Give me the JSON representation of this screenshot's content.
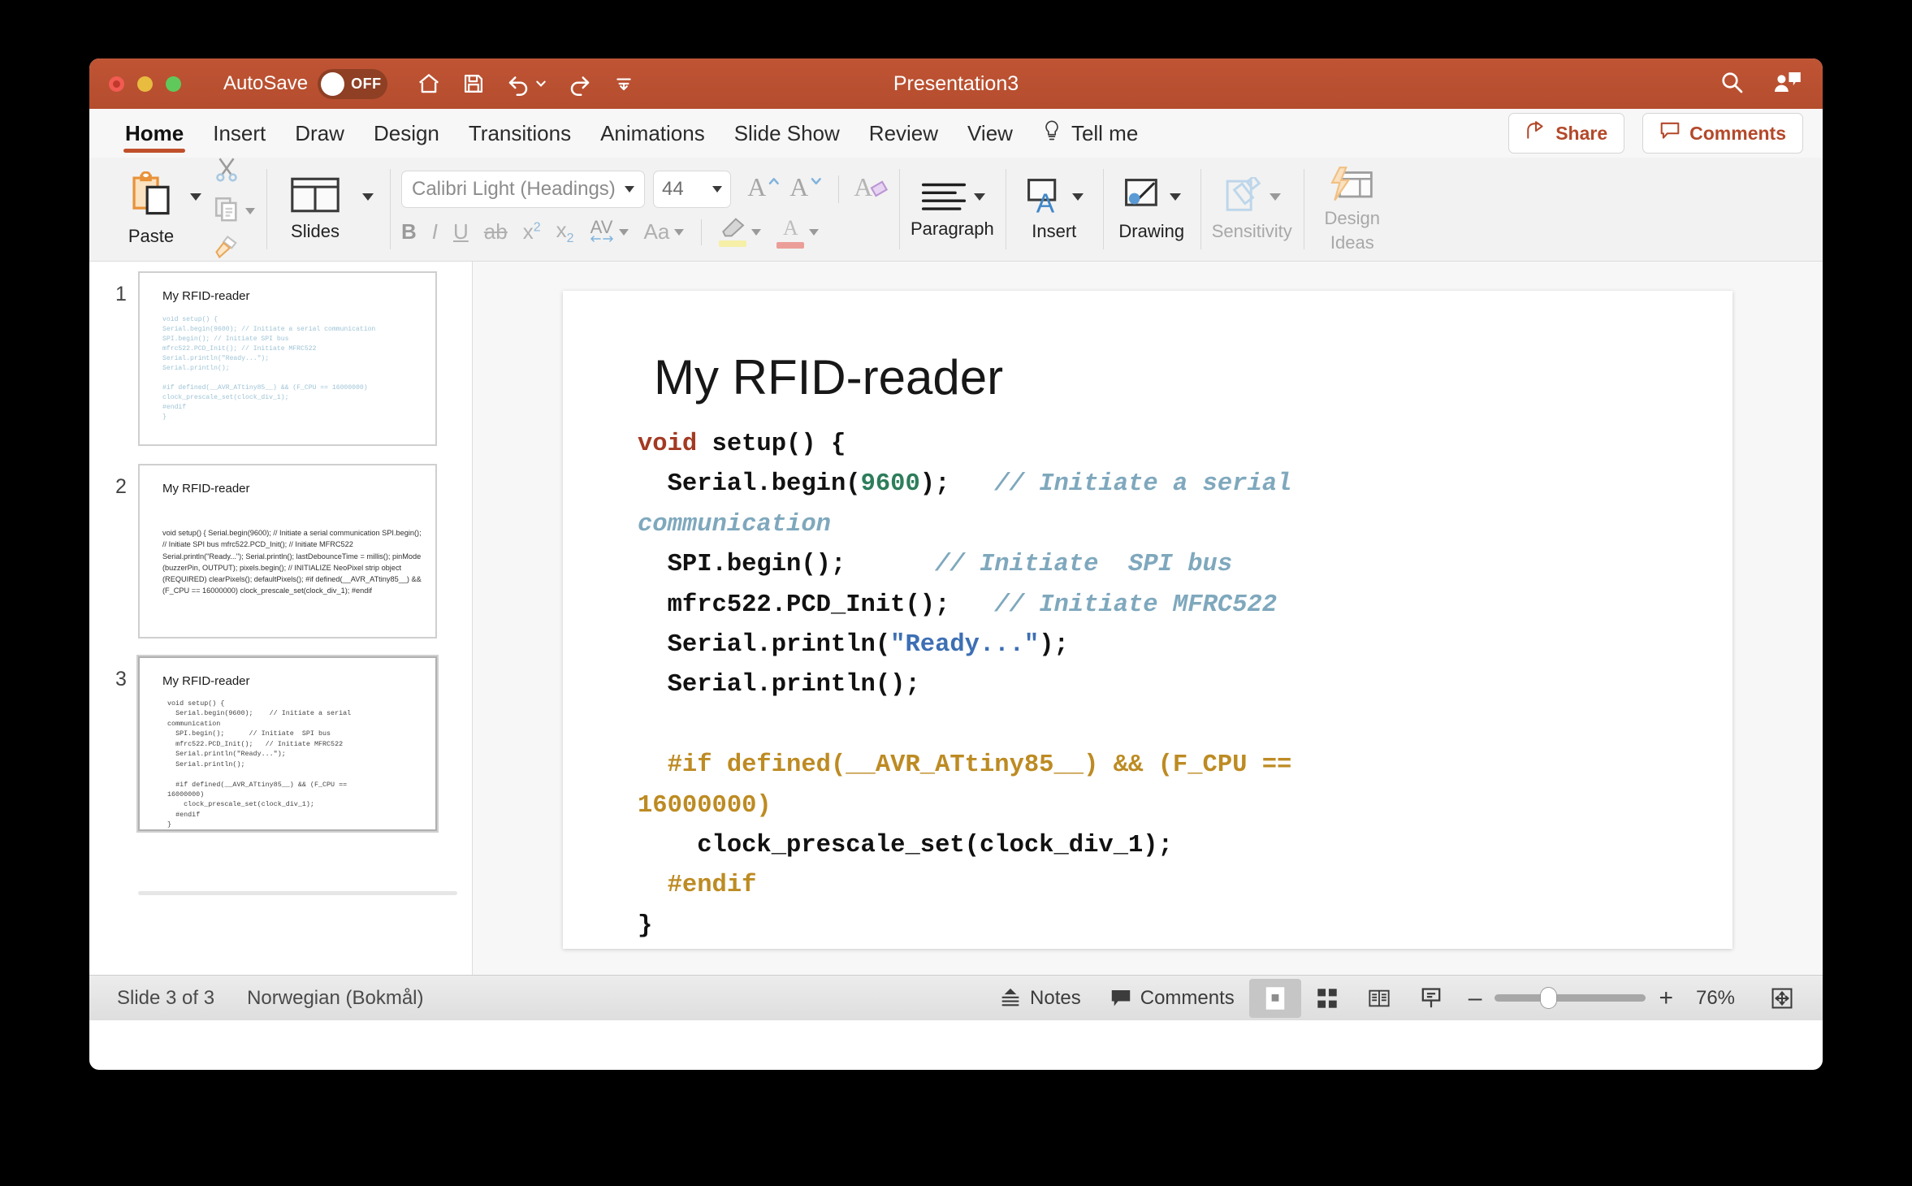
{
  "titlebar": {
    "autosave_label": "AutoSave",
    "autosave_state": "OFF",
    "window_title": "Presentation3",
    "icons": [
      "home-icon",
      "save-icon",
      "undo-icon",
      "redo-icon",
      "customize-toolbar-icon",
      "search-icon",
      "account-icon"
    ]
  },
  "tabs": [
    {
      "label": "Home",
      "active": true
    },
    {
      "label": "Insert",
      "active": false
    },
    {
      "label": "Draw",
      "active": false
    },
    {
      "label": "Design",
      "active": false
    },
    {
      "label": "Transitions",
      "active": false
    },
    {
      "label": "Animations",
      "active": false
    },
    {
      "label": "Slide Show",
      "active": false
    },
    {
      "label": "Review",
      "active": false
    },
    {
      "label": "View",
      "active": false
    },
    {
      "label": "Tell me",
      "active": false
    }
  ],
  "tab_actions": {
    "share_label": "Share",
    "comments_label": "Comments"
  },
  "ribbon": {
    "paste_label": "Paste",
    "slides_label": "Slides",
    "font_name": "Calibri Light (Headings)",
    "font_size": "44",
    "bold": "B",
    "italic": "I",
    "underline": "U",
    "strikethrough": "ab",
    "superscript": "x",
    "superscript_sup": "2",
    "subscript": "x",
    "subscript_sub": "2",
    "char_spacing": "AV",
    "change_case": "Aa",
    "highlight_letter": "A",
    "font_color_letter": "A",
    "grow_font": "A",
    "shrink_font": "A",
    "clear_format": "A",
    "paragraph_label": "Paragraph",
    "insert_label": "Insert",
    "drawing_label": "Drawing",
    "sensitivity_label": "Sensitivity",
    "design_ideas_label_1": "Design",
    "design_ideas_label_2": "Ideas"
  },
  "thumbnails": [
    {
      "number": "1",
      "title": "My RFID-reader",
      "body": "void setup() {\nSerial.begin(9600); // Initiate a serial communication\nSPI.begin(); // Initiate SPI bus\nmfrc522.PCD_Init(); // Initiate MFRC522\nSerial.println(\"Ready...\");\nSerial.println();\n\n#if defined(__AVR_ATtiny85__) && (F_CPU == 16000000)\nclock_prescale_set(clock_div_1);\n#endif\n}",
      "selected": false
    },
    {
      "number": "2",
      "title": "My RFID-reader",
      "body": "void setup() { Serial.begin(9600); // Initiate a serial communication SPI.begin(); // Initiate SPI bus mfrc522.PCD_Init(); // Initiate MFRC522 Serial.println(\"Ready...\"); Serial.println(); lastDebounceTime = millis(); pinMode (buzzerPin, OUTPUT); pixels.begin(); // INITIALIZE NeoPixel strip object (REQUIRED) clearPixels(); defaultPixels(); #if defined(__AVR_ATtiny85__) && (F_CPU == 16000000) clock_prescale_set(clock_div_1); #endif",
      "selected": false
    },
    {
      "number": "3",
      "title": "My RFID-reader",
      "body": "void setup() {\n  Serial.begin(9600);    // Initiate a serial\ncommunication\n  SPI.begin();      // Initiate  SPI bus\n  mfrc522.PCD_Init();   // Initiate MFRC522\n  Serial.println(\"Ready...\");\n  Serial.println();\n\n  #if defined(__AVR_ATtiny85__) && (F_CPU ==\n16000000)\n    clock_prescale_set(clock_div_1);\n  #endif\n}",
      "selected": true
    }
  ],
  "slide": {
    "title": "My RFID-reader",
    "code_lines": [
      {
        "tokens": [
          {
            "t": "void",
            "c": "c-kw"
          },
          {
            "t": " setup() {",
            "c": "c-plain"
          }
        ]
      },
      {
        "tokens": [
          {
            "t": "  Serial.begin(",
            "c": "c-plain"
          },
          {
            "t": "9600",
            "c": "c-num"
          },
          {
            "t": ");   ",
            "c": "c-plain"
          },
          {
            "t": "// Initiate a serial",
            "c": "c-cmt"
          }
        ]
      },
      {
        "tokens": [
          {
            "t": "communication",
            "c": "c-cmt"
          }
        ]
      },
      {
        "tokens": [
          {
            "t": "  SPI.begin();      ",
            "c": "c-plain"
          },
          {
            "t": "// Initiate  SPI bus",
            "c": "c-cmt"
          }
        ]
      },
      {
        "tokens": [
          {
            "t": "  mfrc522.PCD_Init();   ",
            "c": "c-plain"
          },
          {
            "t": "// Initiate MFRC522",
            "c": "c-cmt"
          }
        ]
      },
      {
        "tokens": [
          {
            "t": "  Serial.println(",
            "c": "c-plain"
          },
          {
            "t": "\"Ready...\"",
            "c": "c-str"
          },
          {
            "t": ");",
            "c": "c-plain"
          }
        ]
      },
      {
        "tokens": [
          {
            "t": "  Serial.println();",
            "c": "c-plain"
          }
        ]
      },
      {
        "tokens": [
          {
            "t": " ",
            "c": "c-plain"
          }
        ]
      },
      {
        "tokens": [
          {
            "t": "  #if defined(__AVR_ATtiny85__) && (F_CPU ==",
            "c": "c-pre"
          }
        ]
      },
      {
        "tokens": [
          {
            "t": "16000000)",
            "c": "c-pre"
          }
        ]
      },
      {
        "tokens": [
          {
            "t": "    clock_prescale_set(clock_div_1);",
            "c": "c-plain"
          }
        ]
      },
      {
        "tokens": [
          {
            "t": "  #endif",
            "c": "c-pre"
          }
        ]
      },
      {
        "tokens": [
          {
            "t": "}",
            "c": "c-plain"
          }
        ]
      }
    ]
  },
  "statusbar": {
    "slide_counter": "Slide 3 of 3",
    "language": "Norwegian (Bokmål)",
    "notes_label": "Notes",
    "comments_label": "Comments",
    "zoom_percent": "76%",
    "zoom_out": "–",
    "zoom_in": "+"
  },
  "colors": {
    "titlebar": "#b44d2e",
    "accent": "#c0502b",
    "ribbon_bg": "#f2f2f2"
  }
}
